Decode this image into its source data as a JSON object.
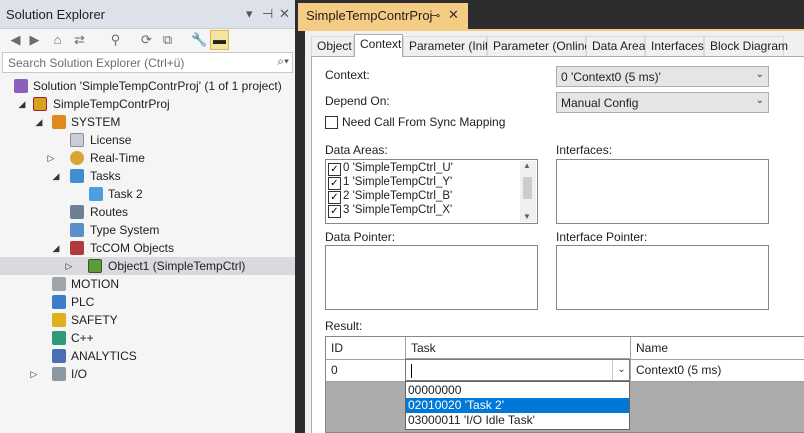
{
  "solution_explorer": {
    "title": "Solution Explorer",
    "title_icons": [
      "chevron-down-icon",
      "pin-icon",
      "close-icon"
    ],
    "search_placeholder": "Search Solution Explorer (Ctrl+ü)",
    "tree": [
      {
        "label": "Solution 'SimpleTempContrProj' (1 of 1 project)",
        "icon": "solution-icon"
      },
      {
        "label": "SimpleTempContrProj",
        "icon": "project-icon"
      },
      {
        "label": "SYSTEM",
        "icon": "system-icon"
      },
      {
        "label": "License",
        "icon": "license-icon"
      },
      {
        "label": "Real-Time",
        "icon": "realtime-icon"
      },
      {
        "label": "Tasks",
        "icon": "tasks-icon"
      },
      {
        "label": "Task 2",
        "icon": "task-icon"
      },
      {
        "label": "Routes",
        "icon": "routes-icon"
      },
      {
        "label": "Type System",
        "icon": "type-system-icon"
      },
      {
        "label": "TcCOM Objects",
        "icon": "tccom-icon"
      },
      {
        "label": "Object1 (SimpleTempCtrl)",
        "icon": "object-icon"
      },
      {
        "label": "MOTION",
        "icon": "motion-icon"
      },
      {
        "label": "PLC",
        "icon": "plc-icon"
      },
      {
        "label": "SAFETY",
        "icon": "safety-icon"
      },
      {
        "label": "C++",
        "icon": "cpp-icon"
      },
      {
        "label": "ANALYTICS",
        "icon": "analytics-icon"
      },
      {
        "label": "I/O",
        "icon": "io-icon"
      }
    ]
  },
  "document": {
    "tab_title": "SimpleTempContrProj",
    "tabs": [
      "Object",
      "Context",
      "Parameter (Init)",
      "Parameter (Online)",
      "Data Area",
      "Interfaces",
      "Block Diagram"
    ],
    "active_tab": "Context",
    "context_label": "Context:",
    "context_value": "0 'Context0 (5 ms)'",
    "depend_on_label": "Depend On:",
    "depend_on_value": "Manual Config",
    "need_call_label": "Need Call From Sync Mapping",
    "data_areas_label": "Data Areas:",
    "data_areas": [
      "0 'SimpleTempCtrl_U'",
      "1 'SimpleTempCtrl_Y'",
      "2 'SimpleTempCtrl_B'",
      "3 'SimpleTempCtrl_X'"
    ],
    "interfaces_label": "Interfaces:",
    "data_pointer_label": "Data Pointer:",
    "interface_pointer_label": "Interface Pointer:",
    "result_label": "Result:",
    "result_columns": [
      "ID",
      "Task",
      "Name"
    ],
    "result_row": {
      "id": "0",
      "task": "",
      "name": "Context0 (5 ms)"
    },
    "task_options": [
      "00000000",
      "02010020 'Task 2'",
      "03000011 'I/O Idle Task'"
    ],
    "task_selected_option": "02010020 'Task 2'"
  },
  "colors": {
    "doc_tab": "#f5cc84",
    "dark_chrome": "#2d2d30",
    "highlight": "#0078d7",
    "panel_bg": "#f0f0f0"
  }
}
